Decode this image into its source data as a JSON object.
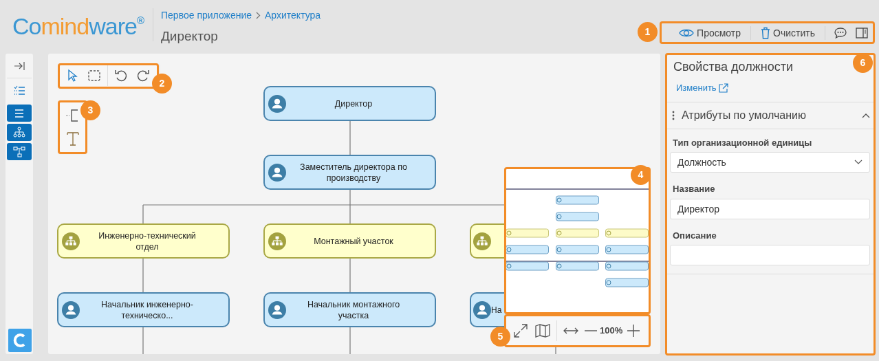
{
  "header": {
    "logo": [
      {
        "text": "Co",
        "color": "#3b97d3"
      },
      {
        "text": "mind",
        "color": "#f39c33"
      },
      {
        "text": "ware",
        "color": "#3b97d3"
      },
      {
        "text": "®",
        "color": "#3b97d3"
      }
    ],
    "breadcrumb": [
      "Первое приложение",
      "Архитектура"
    ],
    "title": "Директор"
  },
  "toolbar": [
    {
      "kind": "preview",
      "label": "Просмотр"
    },
    {
      "kind": "clear",
      "label": "Очистить"
    },
    {
      "kind": "comments"
    },
    {
      "kind": "panel"
    }
  ],
  "rail": [
    {
      "kind": "collapse",
      "highlighted": false
    },
    {
      "kind": "checklist",
      "highlighted": false
    },
    {
      "kind": "list",
      "highlighted": true
    },
    {
      "kind": "org",
      "highlighted": true
    },
    {
      "kind": "tree",
      "highlighted": true
    }
  ],
  "diagram": {
    "nodes": [
      {
        "kind": "position",
        "text": "Директор"
      },
      {
        "kind": "position",
        "text": "Заместитель директора по производству"
      },
      {
        "kind": "unit",
        "text": "Инженерно-технический отдел"
      },
      {
        "kind": "unit",
        "text": "Монтажный участок"
      },
      {
        "kind": "unit"
      },
      {
        "kind": "position",
        "text": "Начальник инженерно-техническо..."
      },
      {
        "kind": "position",
        "text": "Начальник монтажного участка"
      },
      {
        "kind": "position",
        "text": "На"
      }
    ],
    "zoom": "100%"
  },
  "properties": {
    "title": "Свойства должности",
    "edit_link": "Изменить",
    "section": {
      "title": "Атрибуты по умолчанию",
      "expanded": true
    },
    "fields": [
      {
        "kind": "select",
        "label": "Тип организационной единицы",
        "value": "Должность"
      },
      {
        "kind": "text",
        "label": "Название",
        "value": "Директор"
      },
      {
        "kind": "text",
        "label": "Описание"
      }
    ]
  },
  "callouts": [
    "1",
    "2",
    "3",
    "4",
    "5",
    "6"
  ]
}
